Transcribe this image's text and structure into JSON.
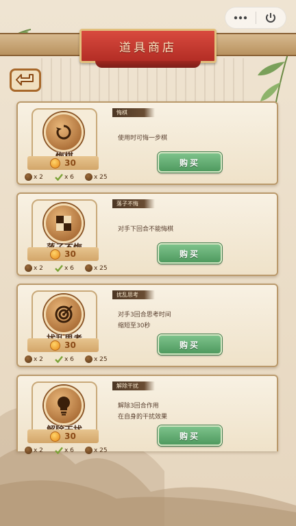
{
  "title": "道具商店",
  "colors": {
    "title_red": "#c23a30",
    "buy_green": "#5fae6d",
    "wood_brown": "#a8682a"
  },
  "icons": {
    "menu": "more-dots-icon",
    "close": "power-icon",
    "back": "back-arrow-icon"
  },
  "items": [
    {
      "name": "悔棋",
      "icon": "undo-icon",
      "price": "30",
      "tag": "悔棋",
      "desc_line1": "使用时可悔一步棋",
      "desc_line2": "",
      "buy_label": "购买",
      "count_a": "x 2",
      "count_b": "x 6",
      "count_c": "x 25"
    },
    {
      "name": "落子不悔",
      "icon": "no-undo-icon",
      "price": "30",
      "tag": "落子不悔",
      "desc_line1": "对手下回合不能悔棋",
      "desc_line2": "",
      "buy_label": "购买",
      "count_a": "x 2",
      "count_b": "x 6",
      "count_c": "x 25"
    },
    {
      "name": "扰乱思考",
      "icon": "target-icon",
      "price": "30",
      "tag": "扰乱思考",
      "desc_line1": "对手3回合思考时间",
      "desc_line2": "缩短至30秒",
      "buy_label": "购买",
      "count_a": "x 2",
      "count_b": "x 6",
      "count_c": "x 25"
    },
    {
      "name": "解除干扰",
      "icon": "lightbulb-icon",
      "price": "30",
      "tag": "解除干扰",
      "desc_line1": "解除3回合作用",
      "desc_line2": "在自身的干扰效果",
      "buy_label": "购买",
      "count_a": "x 2",
      "count_b": "x 6",
      "count_c": "x 25"
    }
  ]
}
